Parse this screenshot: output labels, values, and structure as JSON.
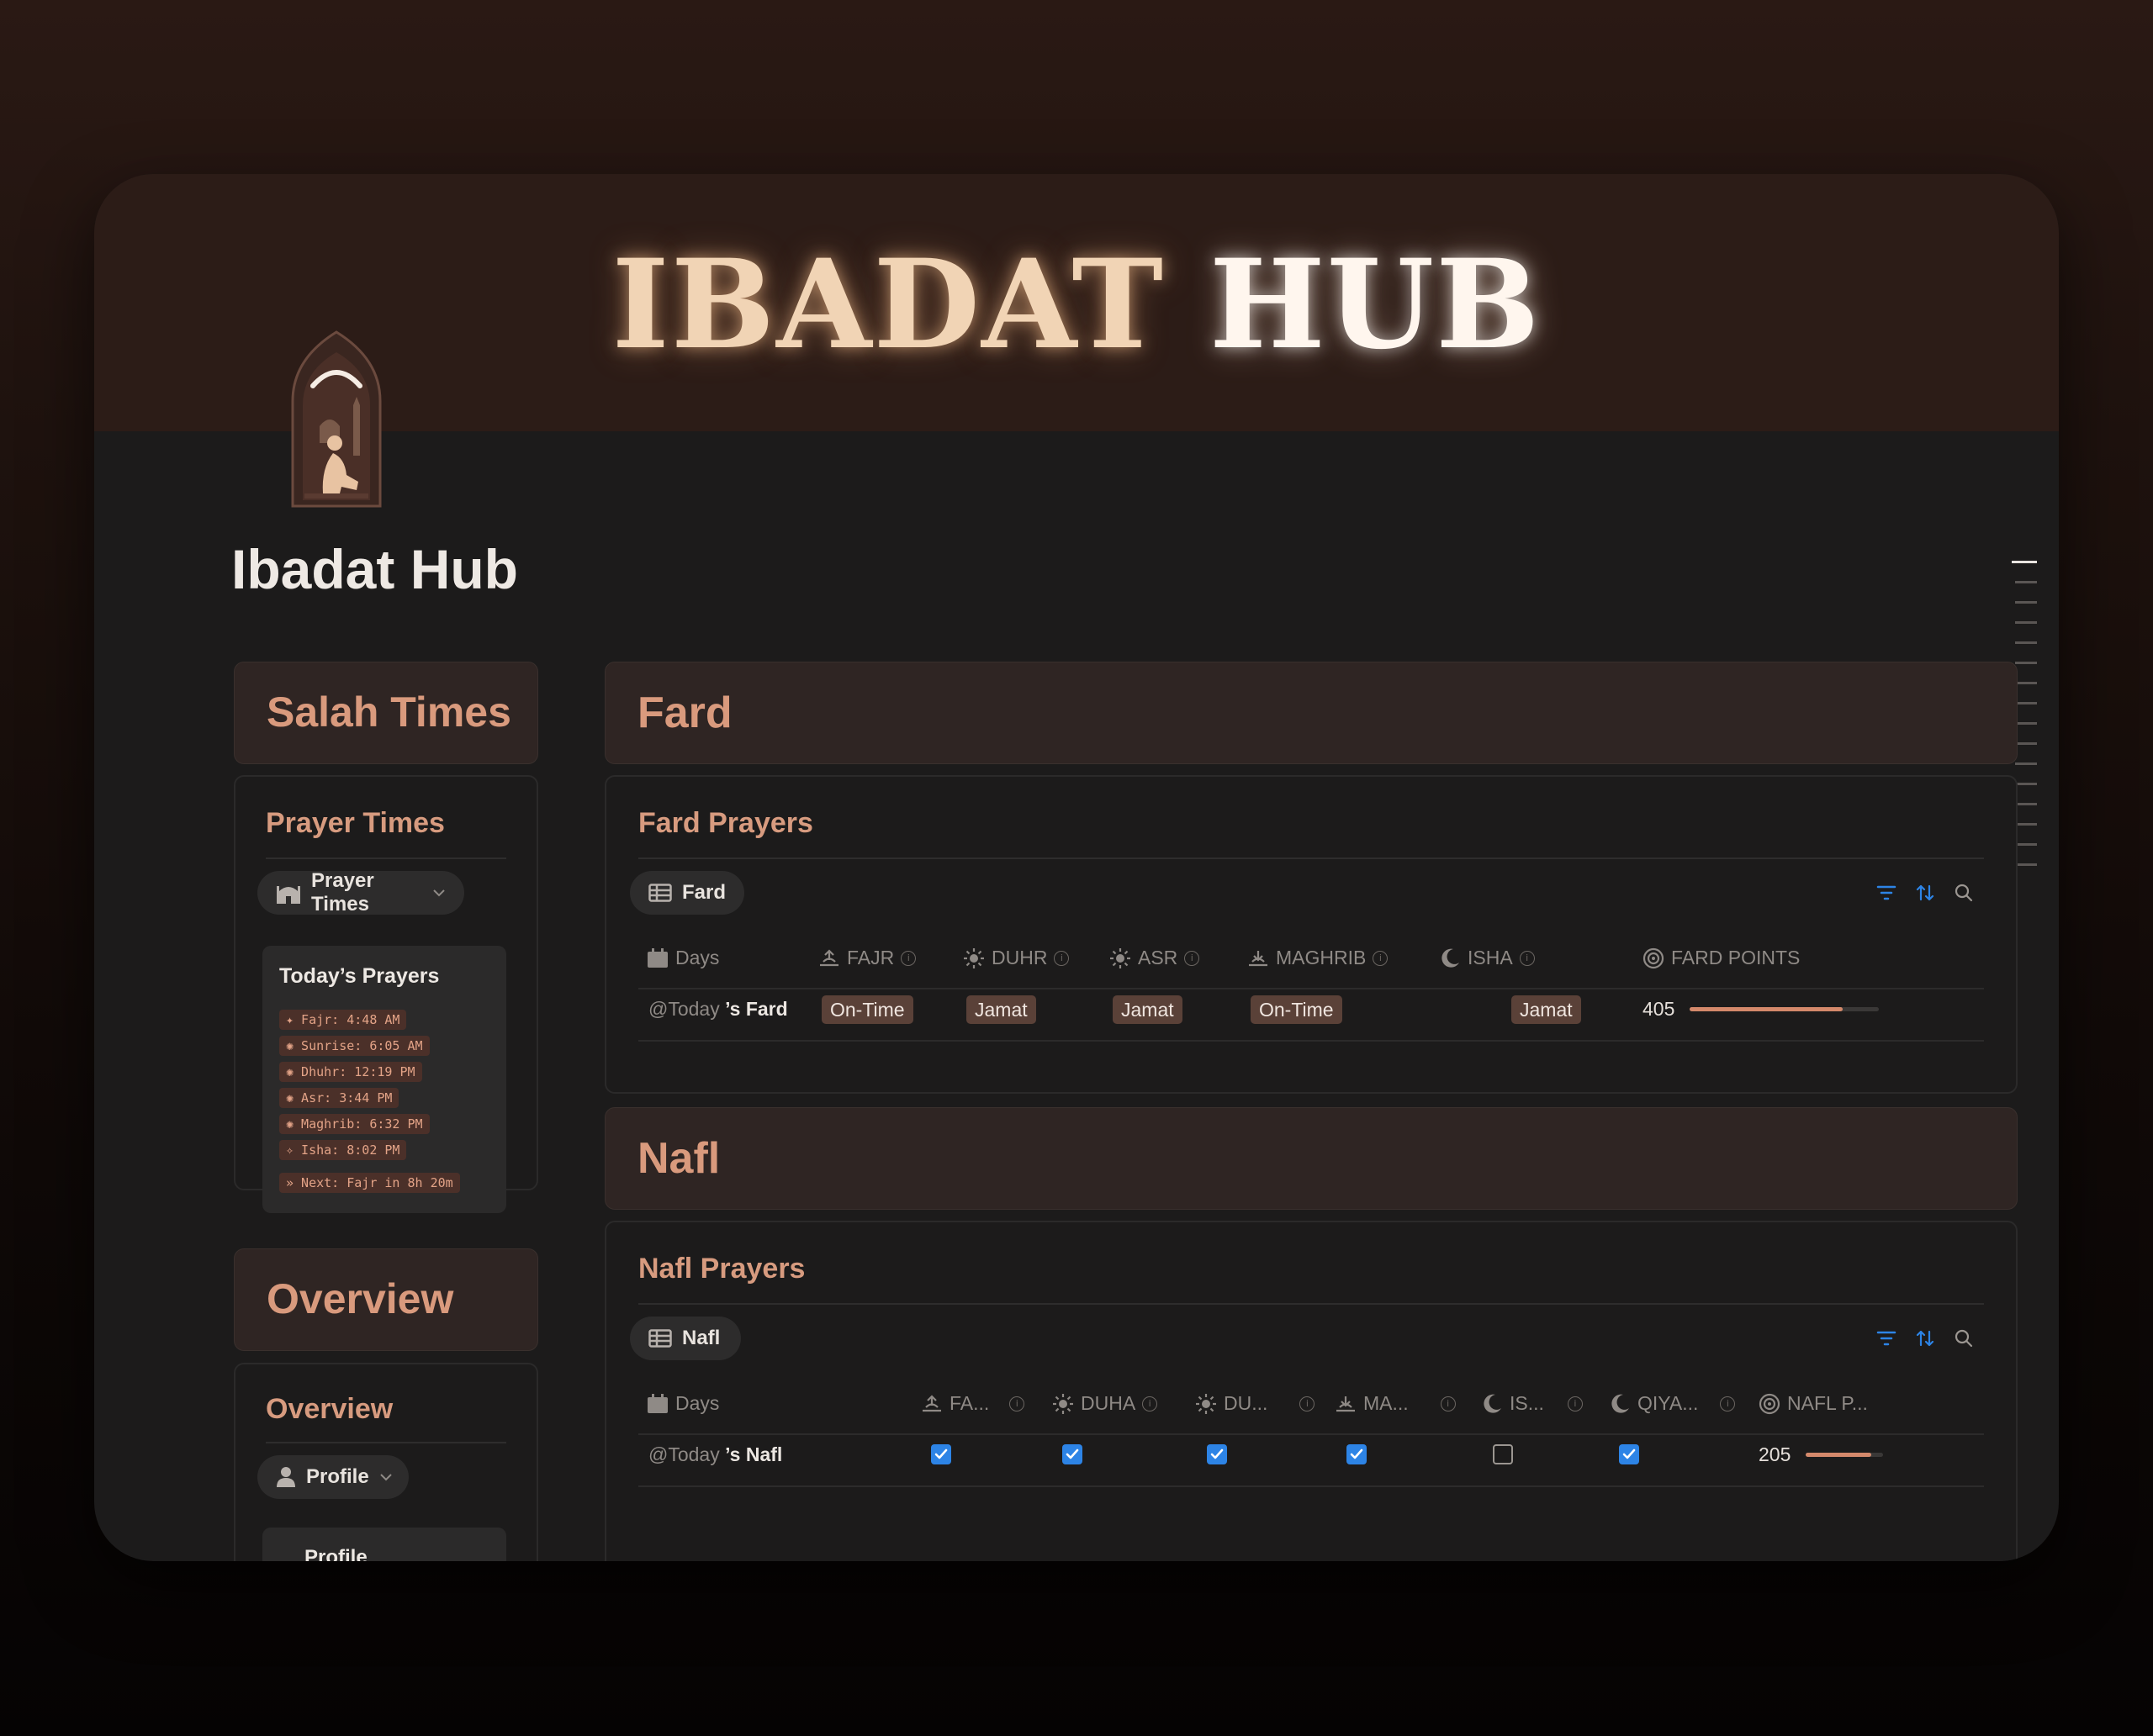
{
  "header": {
    "hero_word1": "IBADAT",
    "hero_word2": "HUB",
    "page_title": "Ibadat Hub"
  },
  "sidebar": {
    "salah_section_title": "Salah Times",
    "prayer_times_heading": "Prayer Times",
    "prayer_times_pill": "Prayer Times",
    "today_card": {
      "title": "Today’s Prayers",
      "items": [
        "✦ Fajr: 4:48 AM",
        "✺ Sunrise: 6:05 AM",
        "✺ Dhuhr: 12:19 PM",
        "✺ Asr: 3:44 PM",
        "✺ Maghrib: 6:32 PM",
        "✧ Isha: 8:02 PM"
      ],
      "next": "» Next: Fajr in 8h 20m"
    },
    "overview_section_title": "Overview",
    "overview_heading": "Overview",
    "profile_pill": "Profile",
    "profile_card_partial": "Profile"
  },
  "fard": {
    "section_title": "Fard",
    "db_title": "Fard Prayers",
    "view_tab": "Fard",
    "columns": [
      "Days",
      "FAJR",
      "DUHR",
      "ASR",
      "MAGHRIB",
      "ISHA",
      "FARD POINTS"
    ],
    "row": {
      "day_mention": "@Today",
      "day_suffix": "’s Fard",
      "fajr": "On-Time",
      "duhr": "Jamat",
      "asr": "Jamat",
      "maghrib": "On-Time",
      "isha": "Jamat",
      "points": "405",
      "points_progress": 0.81
    }
  },
  "nafl": {
    "section_title": "Nafl",
    "db_title": "Nafl Prayers",
    "view_tab": "Nafl",
    "columns": [
      "Days",
      "FA...",
      "DUHA",
      "DU...",
      "MA...",
      "IS...",
      "QIYA...",
      "NAFL P..."
    ],
    "row": {
      "day_mention": "@Today",
      "day_suffix": "’s Nafl",
      "checks": [
        true,
        true,
        true,
        true,
        false,
        true
      ],
      "points": "205",
      "points_progress": 0.85
    }
  },
  "colors": {
    "accent": "#d99a7d",
    "banner": "#2c1c17",
    "checkbox": "#2d84e6"
  }
}
